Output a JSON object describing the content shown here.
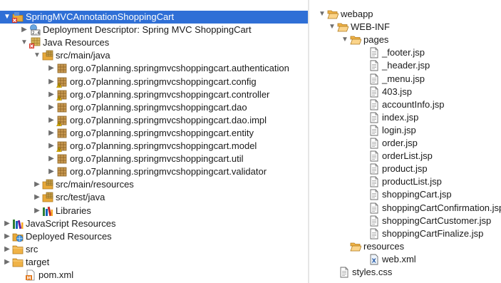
{
  "left_tree": [
    {
      "label": "SpringMVCAnnotationShoppingCart",
      "icon": "project-icon",
      "toggle": "expanded",
      "selected": true
    },
    {
      "label": "Deployment Descriptor: Spring MVC ShoppingCart",
      "icon": "deployment-descriptor-icon",
      "toggle": "collapsed"
    },
    {
      "label": "Java Resources",
      "icon": "java-resources-icon",
      "toggle": "expanded"
    },
    {
      "label": "src/main/java",
      "icon": "source-folder-icon",
      "toggle": "expanded"
    },
    {
      "label": "org.o7planning.springmvcshoppingcart.authentication",
      "icon": "package-icon",
      "toggle": "collapsed"
    },
    {
      "label": "org.o7planning.springmvcshoppingcart.config",
      "icon": "package-warning-icon",
      "toggle": "collapsed"
    },
    {
      "label": "org.o7planning.springmvcshoppingcart.controller",
      "icon": "package-warning-icon",
      "toggle": "collapsed"
    },
    {
      "label": "org.o7planning.springmvcshoppingcart.dao",
      "icon": "package-icon",
      "toggle": "collapsed"
    },
    {
      "label": "org.o7planning.springmvcshoppingcart.dao.impl",
      "icon": "package-warning-icon",
      "toggle": "collapsed"
    },
    {
      "label": "org.o7planning.springmvcshoppingcart.entity",
      "icon": "package-icon",
      "toggle": "collapsed"
    },
    {
      "label": "org.o7planning.springmvcshoppingcart.model",
      "icon": "package-warning-icon",
      "toggle": "collapsed"
    },
    {
      "label": "org.o7planning.springmvcshoppingcart.util",
      "icon": "package-icon",
      "toggle": "collapsed"
    },
    {
      "label": "org.o7planning.springmvcshoppingcart.validator",
      "icon": "package-icon",
      "toggle": "collapsed"
    },
    {
      "label": "src/main/resources",
      "icon": "source-folder-icon",
      "toggle": "collapsed"
    },
    {
      "label": "src/test/java",
      "icon": "source-folder-icon",
      "toggle": "collapsed"
    },
    {
      "label": "Libraries",
      "icon": "libraries-icon",
      "toggle": "collapsed"
    },
    {
      "label": "JavaScript Resources",
      "icon": "javascript-resources-icon",
      "toggle": "collapsed"
    },
    {
      "label": "Deployed Resources",
      "icon": "deployed-resources-icon",
      "toggle": "collapsed"
    },
    {
      "label": "src",
      "icon": "folder-icon",
      "toggle": "collapsed"
    },
    {
      "label": "target",
      "icon": "folder-icon",
      "toggle": "collapsed"
    },
    {
      "label": "pom.xml",
      "icon": "maven-pom-icon",
      "toggle": "none"
    }
  ],
  "right_tree": [
    {
      "label": "webapp",
      "icon": "folder-open-icon",
      "toggle": "expanded"
    },
    {
      "label": "WEB-INF",
      "icon": "folder-open-icon",
      "toggle": "expanded"
    },
    {
      "label": "pages",
      "icon": "folder-open-icon",
      "toggle": "expanded"
    },
    {
      "label": "_footer.jsp",
      "icon": "jsp-file-icon",
      "toggle": "none"
    },
    {
      "label": "_header.jsp",
      "icon": "jsp-file-icon",
      "toggle": "none"
    },
    {
      "label": "_menu.jsp",
      "icon": "jsp-file-icon",
      "toggle": "none"
    },
    {
      "label": "403.jsp",
      "icon": "jsp-file-icon",
      "toggle": "none"
    },
    {
      "label": "accountInfo.jsp",
      "icon": "jsp-file-icon",
      "toggle": "none"
    },
    {
      "label": "index.jsp",
      "icon": "jsp-file-icon",
      "toggle": "none"
    },
    {
      "label": "login.jsp",
      "icon": "jsp-file-icon",
      "toggle": "none"
    },
    {
      "label": "order.jsp",
      "icon": "jsp-file-icon",
      "toggle": "none"
    },
    {
      "label": "orderList.jsp",
      "icon": "jsp-file-icon",
      "toggle": "none"
    },
    {
      "label": "product.jsp",
      "icon": "jsp-file-icon",
      "toggle": "none"
    },
    {
      "label": "productList.jsp",
      "icon": "jsp-file-icon",
      "toggle": "none"
    },
    {
      "label": "shoppingCart.jsp",
      "icon": "jsp-file-icon",
      "toggle": "none"
    },
    {
      "label": "shoppingCartConfirmation.jsp",
      "icon": "jsp-file-icon",
      "toggle": "none"
    },
    {
      "label": "shoppingCartCustomer.jsp",
      "icon": "jsp-file-icon",
      "toggle": "none"
    },
    {
      "label": "shoppingCartFinalize.jsp",
      "icon": "jsp-file-icon",
      "toggle": "none"
    },
    {
      "label": "resources",
      "icon": "folder-open-icon",
      "toggle": "none"
    },
    {
      "label": "web.xml",
      "icon": "xml-file-icon",
      "toggle": "none"
    },
    {
      "label": "styles.css",
      "icon": "css-file-icon",
      "toggle": "none"
    }
  ],
  "colors": {
    "selection": "#2f6fd6",
    "folder": "#e8a93a",
    "package": "#b58a3c",
    "warning": "#f2c200",
    "error": "#d73a2c"
  }
}
